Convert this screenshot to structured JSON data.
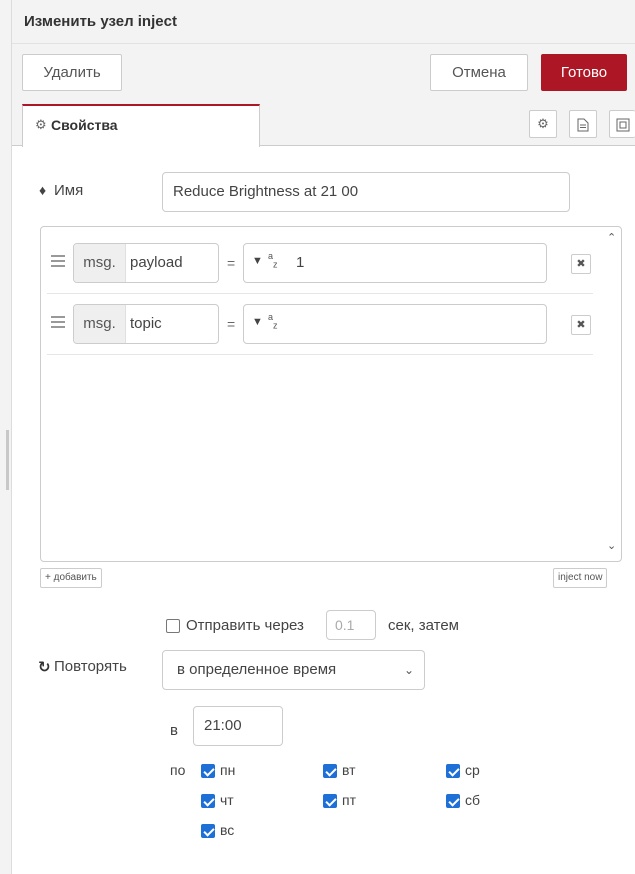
{
  "header": {
    "title": "Изменить узел inject"
  },
  "toolbar": {
    "delete_label": "Удалить",
    "cancel_label": "Отмена",
    "done_label": "Готово",
    "accent": "#ad1625"
  },
  "tabs": {
    "properties_label": "Свойства"
  },
  "name": {
    "label": "Имя",
    "value": "Reduce Brightness at 21 00"
  },
  "props": [
    {
      "prefix": "msg.",
      "key": "payload",
      "eq": "=",
      "type_sup": "a",
      "type_sub": "z",
      "value": "1"
    },
    {
      "prefix": "msg.",
      "key": "topic",
      "eq": "=",
      "type_sup": "a",
      "type_sub": "z",
      "value": ""
    }
  ],
  "buttons": {
    "add_label": "добавить",
    "inject_now_label": "inject now"
  },
  "once": {
    "label": "Отправить через",
    "delay": "0.1",
    "suffix": "сек, затем",
    "checked": false
  },
  "repeat": {
    "label": "Повторять",
    "selected": "в определенное время"
  },
  "schedule": {
    "at_label": "в",
    "time": "21:00",
    "on_label": "по",
    "days": [
      {
        "label": "пн",
        "checked": true
      },
      {
        "label": "вт",
        "checked": true
      },
      {
        "label": "ср",
        "checked": true
      },
      {
        "label": "чт",
        "checked": true
      },
      {
        "label": "пт",
        "checked": true
      },
      {
        "label": "сб",
        "checked": true
      },
      {
        "label": "вс",
        "checked": true
      }
    ]
  },
  "colors": {
    "checkbox": "#1e6fd6"
  }
}
